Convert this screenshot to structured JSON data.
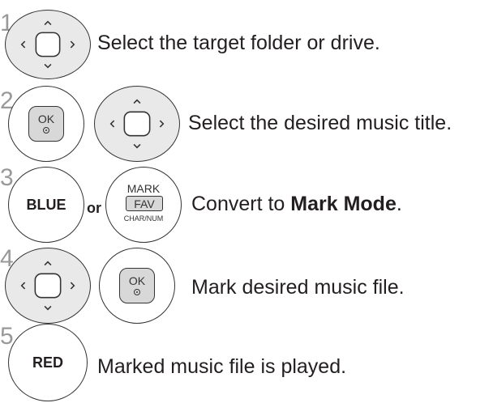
{
  "steps": [
    {
      "number": "1",
      "text": "Select the target folder or drive."
    },
    {
      "number": "2",
      "ok_label": "OK",
      "text": "Select the desired music title."
    },
    {
      "number": "3",
      "blue_label": "BLUE",
      "or_label": "or",
      "mark_top": "MARK",
      "mark_fav": "FAV",
      "mark_bottom": "CHAR/NUM",
      "text_prefix": "Convert to ",
      "text_bold": "Mark Mode",
      "text_suffix": "."
    },
    {
      "number": "4",
      "ok_label": "OK",
      "text": "Mark desired music file."
    },
    {
      "number": "5",
      "red_label": "RED",
      "text": "Marked music file is played."
    }
  ]
}
